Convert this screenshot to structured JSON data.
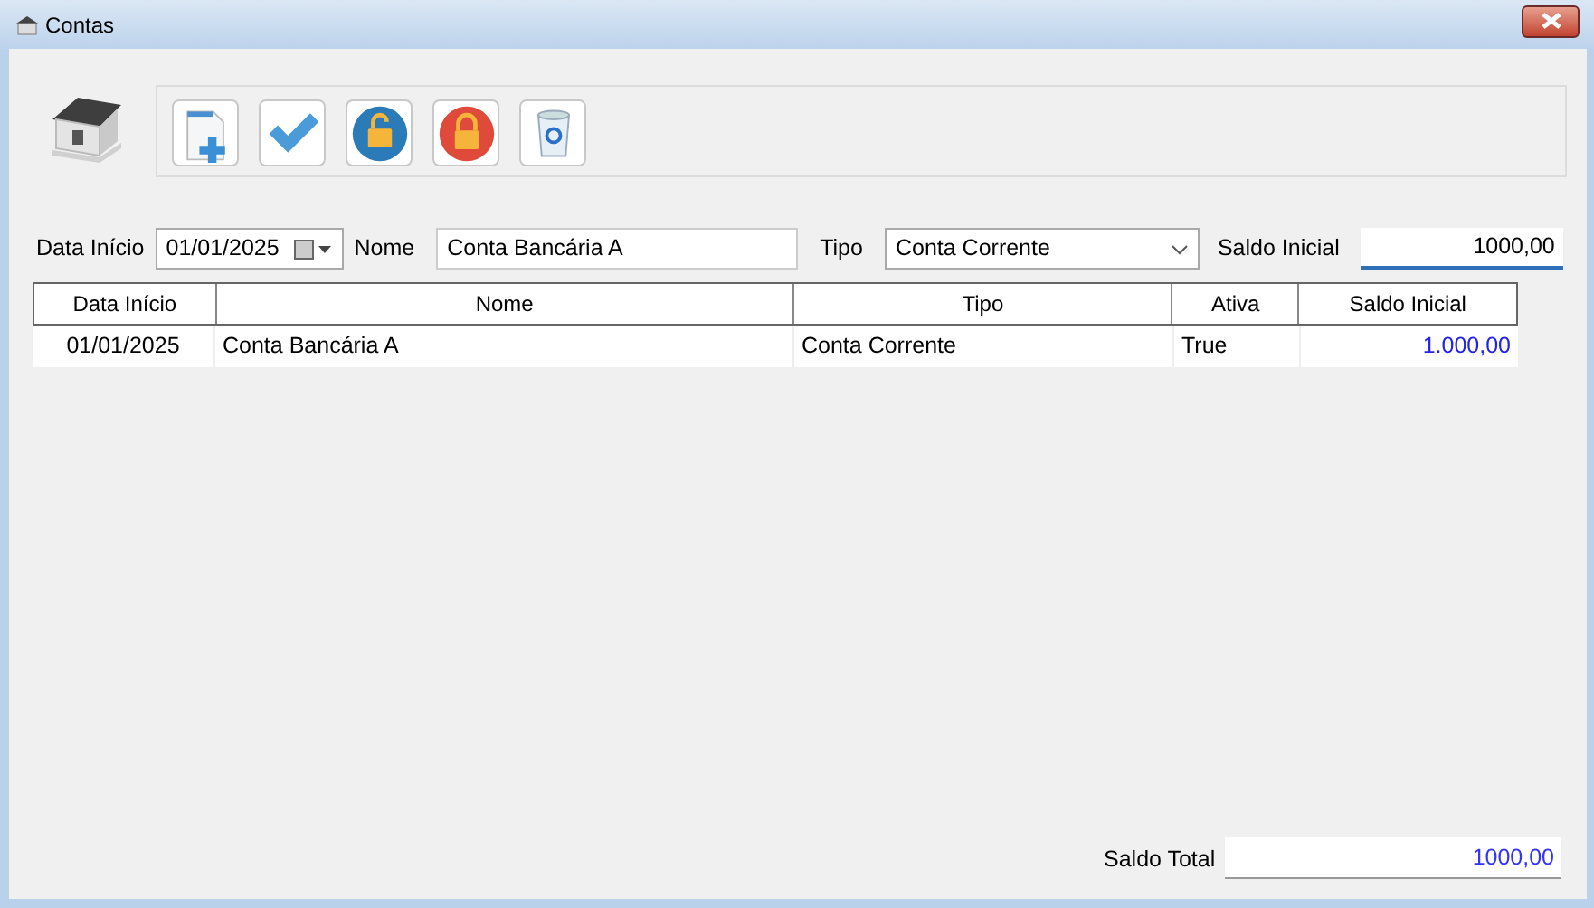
{
  "window": {
    "title": "Contas"
  },
  "toolbar": [
    {
      "kind": "new"
    },
    {
      "kind": "confirm"
    },
    {
      "kind": "unlock"
    },
    {
      "kind": "lock"
    },
    {
      "kind": "delete"
    }
  ],
  "form": {
    "date_label": "Data Início",
    "date_value": "01/01/2025",
    "name_label": "Nome",
    "name_value": "Conta Bancária A",
    "type_label": "Tipo",
    "type_value": "Conta Corrente",
    "balance_label": "Saldo Inicial",
    "balance_value": "1000,00",
    "balance_focused": true
  },
  "table": {
    "columns": [
      "Data Início",
      "Nome",
      "Tipo",
      "Ativa",
      "Saldo Inicial"
    ],
    "rows": [
      [
        "01/01/2025",
        "Conta Bancária A",
        "Conta Corrente",
        "True",
        "1.000,00"
      ]
    ]
  },
  "total": {
    "label": "Saldo Total",
    "value": "1000,00"
  }
}
